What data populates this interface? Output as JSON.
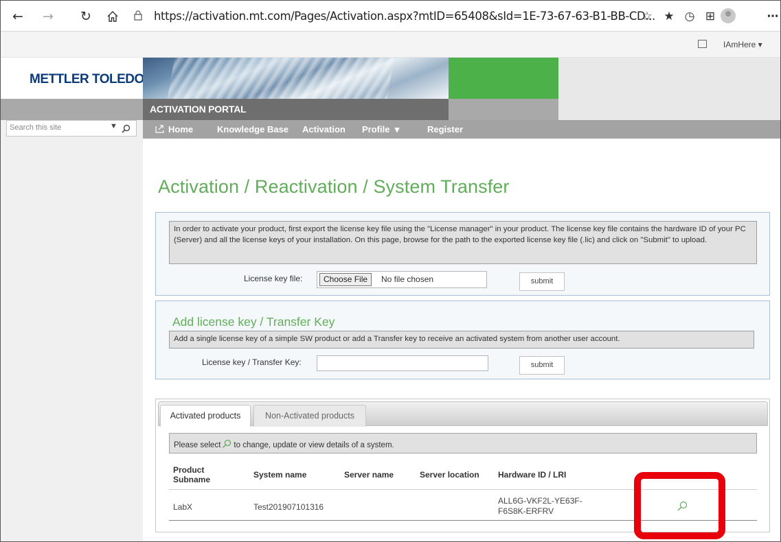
{
  "browser": {
    "url": "https://activation.mt.com/Pages/Activation.aspx?mtID=65408&sId=1E-73-67-63-B1-BB-CD...",
    "nav_icons": [
      "back-arrow-icon",
      "forward-arrow-icon",
      "refresh-icon",
      "home-icon",
      "lock-icon"
    ],
    "toolbar_icons": [
      "add-favorite-icon",
      "favorites-icon",
      "history-icon",
      "collections-icon",
      "profile-avatar-icon",
      "more-icon"
    ]
  },
  "suitebar": {
    "user_menu": "IAmHere"
  },
  "site": {
    "logo_text": "METTLER TOLEDO",
    "portal_title": "ACTIVATION PORTAL",
    "search_placeholder": "Search this site"
  },
  "nav": {
    "items": [
      {
        "label": "Home"
      },
      {
        "label": "Knowledge Base"
      },
      {
        "label": "Activation"
      },
      {
        "label": "Profile"
      },
      {
        "label": "Register"
      }
    ]
  },
  "page": {
    "title": "Activation / Reactivation / System Transfer"
  },
  "upload": {
    "info": "In order to activate your product, first export the license key file using the \"License manager\" in your product. The license key file contains the hardware ID of your PC (Server) and all the license keys of your installation. On this page, browse for the path to the exported license key file (.lic) and click on \"Submit\" to upload.",
    "field_label": "License key file:",
    "choose_label": "Choose File",
    "no_file_label": "No file chosen",
    "submit_label": "submit"
  },
  "addkey": {
    "heading": "Add license key / Transfer Key",
    "info": "Add a single license key of a simple SW product or add a Transfer key to receive an activated system from another user account.",
    "field_label": "License key / Transfer Key:",
    "value": "",
    "submit_label": "submit"
  },
  "products": {
    "tabs": [
      {
        "label": "Activated products",
        "active": true
      },
      {
        "label": "Non-Activated products",
        "active": false
      }
    ],
    "select_prefix": "Please select",
    "select_suffix": "to change, update or view details of a system.",
    "columns": {
      "subname": "Product Subname",
      "system": "System name",
      "server": "Server name",
      "location": "Server location",
      "hardware": "Hardware ID / LRI"
    },
    "rows": [
      {
        "subname": "LabX",
        "system": "Test201907101316",
        "server": "",
        "location": "",
        "hardware": "ALL6G-VKF2L-YE63F-F6S8K-ERFRV"
      }
    ]
  },
  "colors": {
    "accent_green": "#61ad5a",
    "banner_green": "#4db14a",
    "logo_blue": "#0a3a7a",
    "highlight_red": "#e8000b"
  }
}
